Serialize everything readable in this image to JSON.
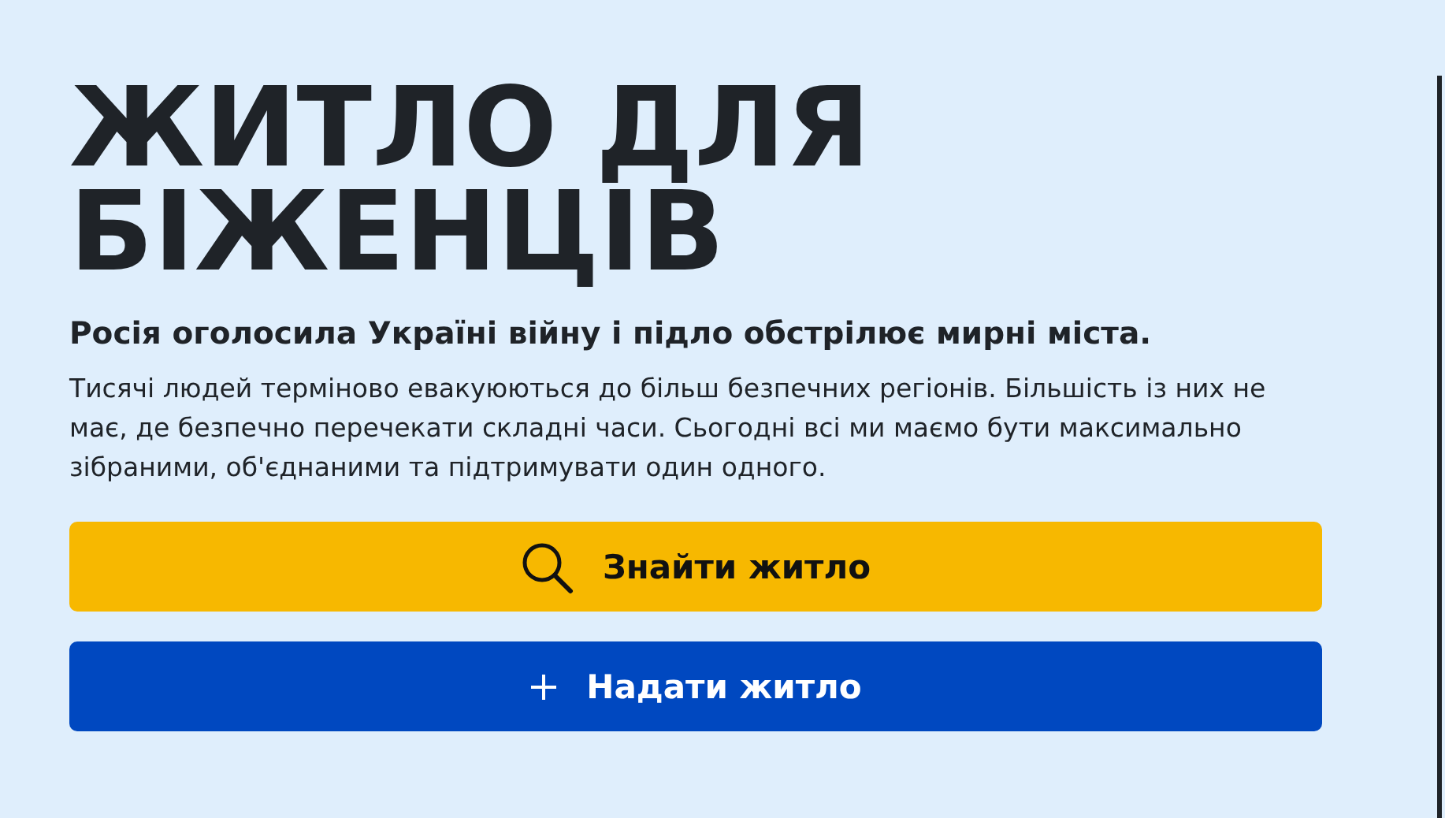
{
  "hero": {
    "title_lines": [
      "ЖИТЛО ДЛЯ",
      "БІЖЕНЦІВ"
    ],
    "subtitle": "Росія оголосила Україні війну і підло обстрілює мирні міста.",
    "description": "Тисячі людей терміново евакуюються до більш безпечних регіонів. Більшість із них не має, де безпечно перечекати складні часи. Сьогодні всі ми маємо бути максимально зібраними, об'єднаними та підтримувати один одного.",
    "buttons": [
      {
        "kind": "search",
        "label": "Знайти житло"
      },
      {
        "kind": "add",
        "label": "Надати житло"
      }
    ]
  }
}
